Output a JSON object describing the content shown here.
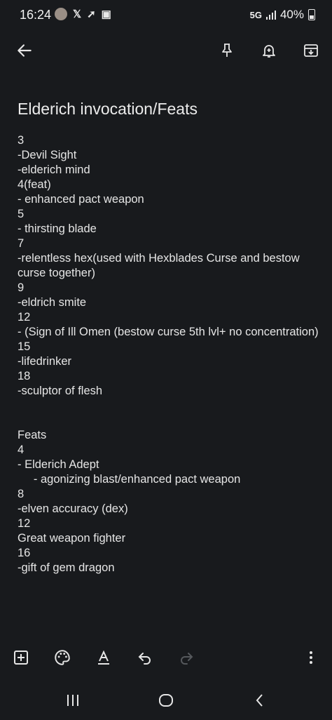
{
  "status": {
    "time": "16:24",
    "network": "5G",
    "battery": "40%"
  },
  "note": {
    "title": "Elderich invocation/Feats",
    "lines": [
      "3",
      "-Devil Sight",
      "-elderich mind",
      "4(feat)",
      "- enhanced pact weapon",
      "5",
      "- thirsting blade",
      "7",
      "-relentless hex(used with Hexblades Curse and bestow curse together)",
      "9",
      "-eldrich smite",
      "12",
      "- (Sign of Ill Omen (bestow curse 5th lvl+ no concentration)",
      "15",
      "-lifedrinker",
      "18",
      "-sculptor of flesh",
      "",
      "",
      "Feats",
      "4",
      "- Elderich Adept",
      "     - agonizing blast/enhanced pact weapon",
      "8",
      "-elven accuracy (dex)",
      "12",
      "Great weapon fighter",
      "16",
      "-gift of gem dragon"
    ]
  },
  "icons": {
    "back": "arrow-left-icon",
    "pin": "pin-icon",
    "reminder": "bell-plus-icon",
    "archive": "archive-icon",
    "add": "add-box-icon",
    "palette": "palette-icon",
    "format": "text-format-icon",
    "undo": "undo-icon",
    "redo": "redo-icon",
    "more": "more-vert-icon"
  }
}
